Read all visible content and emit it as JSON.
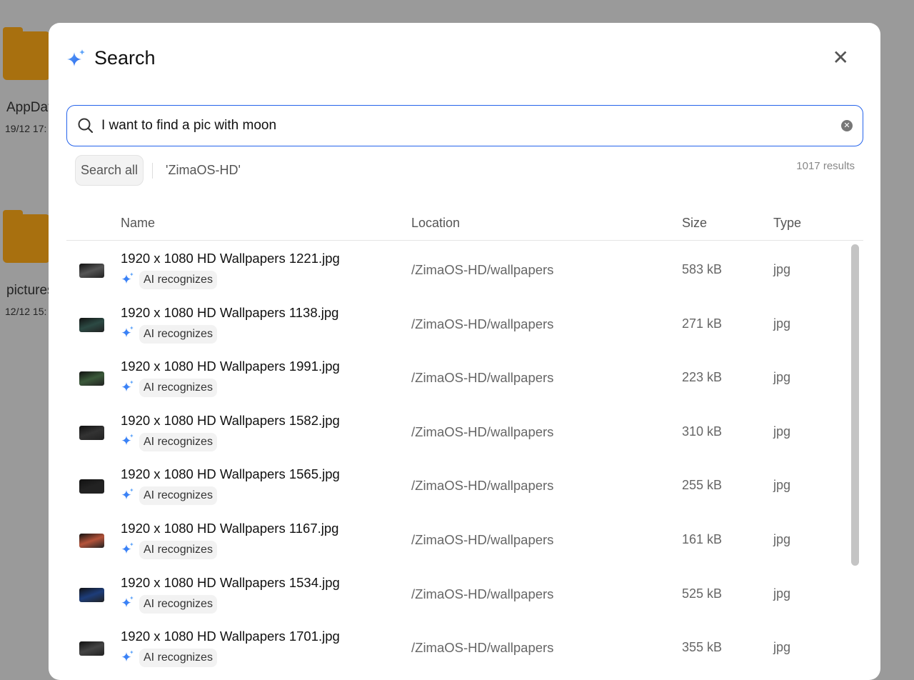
{
  "background": {
    "items": [
      {
        "name": "AppData",
        "date": "19/12 17:"
      },
      {
        "name": "pictures",
        "date": "12/12 15:"
      }
    ]
  },
  "modal": {
    "title": "Search",
    "close_icon": "close-icon",
    "title_icon": "sparkle-icon"
  },
  "search": {
    "value": "I want to find a pic with moon",
    "placeholder": ""
  },
  "filters": {
    "search_all": "Search all",
    "scope": "'ZimaOS-HD'"
  },
  "results_count": "1017 results",
  "table": {
    "headers": {
      "name": "Name",
      "location": "Location",
      "size": "Size",
      "type": "Type"
    },
    "rows": [
      {
        "name": "1920 x 1080 HD Wallpapers 1221.jpg",
        "badge": "AI recognizes",
        "location": "/ZimaOS-HD/wallpapers",
        "size": "583 kB",
        "type": "jpg",
        "thumb": "#555"
      },
      {
        "name": "1920 x 1080 HD Wallpapers 1138.jpg",
        "badge": "AI recognizes",
        "location": "/ZimaOS-HD/wallpapers",
        "size": "271 kB",
        "type": "jpg",
        "thumb": "#2c4a44"
      },
      {
        "name": "1920 x 1080 HD Wallpapers 1991.jpg",
        "badge": "AI recognizes",
        "location": "/ZimaOS-HD/wallpapers",
        "size": "223 kB",
        "type": "jpg",
        "thumb": "#3b5a3a"
      },
      {
        "name": "1920 x 1080 HD Wallpapers 1582.jpg",
        "badge": "AI recognizes",
        "location": "/ZimaOS-HD/wallpapers",
        "size": "310 kB",
        "type": "jpg",
        "thumb": "#333"
      },
      {
        "name": "1920 x 1080 HD Wallpapers 1565.jpg",
        "badge": "AI recognizes",
        "location": "/ZimaOS-HD/wallpapers",
        "size": "255 kB",
        "type": "jpg",
        "thumb": "#222"
      },
      {
        "name": "1920 x 1080 HD Wallpapers 1167.jpg",
        "badge": "AI recognizes",
        "location": "/ZimaOS-HD/wallpapers",
        "size": "161 kB",
        "type": "jpg",
        "thumb": "#b5533a"
      },
      {
        "name": "1920 x 1080 HD Wallpapers 1534.jpg",
        "badge": "AI recognizes",
        "location": "/ZimaOS-HD/wallpapers",
        "size": "525 kB",
        "type": "jpg",
        "thumb": "#1d3d7a"
      },
      {
        "name": "1920 x 1080 HD Wallpapers 1701.jpg",
        "badge": "AI recognizes",
        "location": "/ZimaOS-HD/wallpapers",
        "size": "355 kB",
        "type": "jpg",
        "thumb": "#444"
      }
    ]
  },
  "colors": {
    "accent": "#2563eb",
    "sparkle": "#3b82f6"
  }
}
